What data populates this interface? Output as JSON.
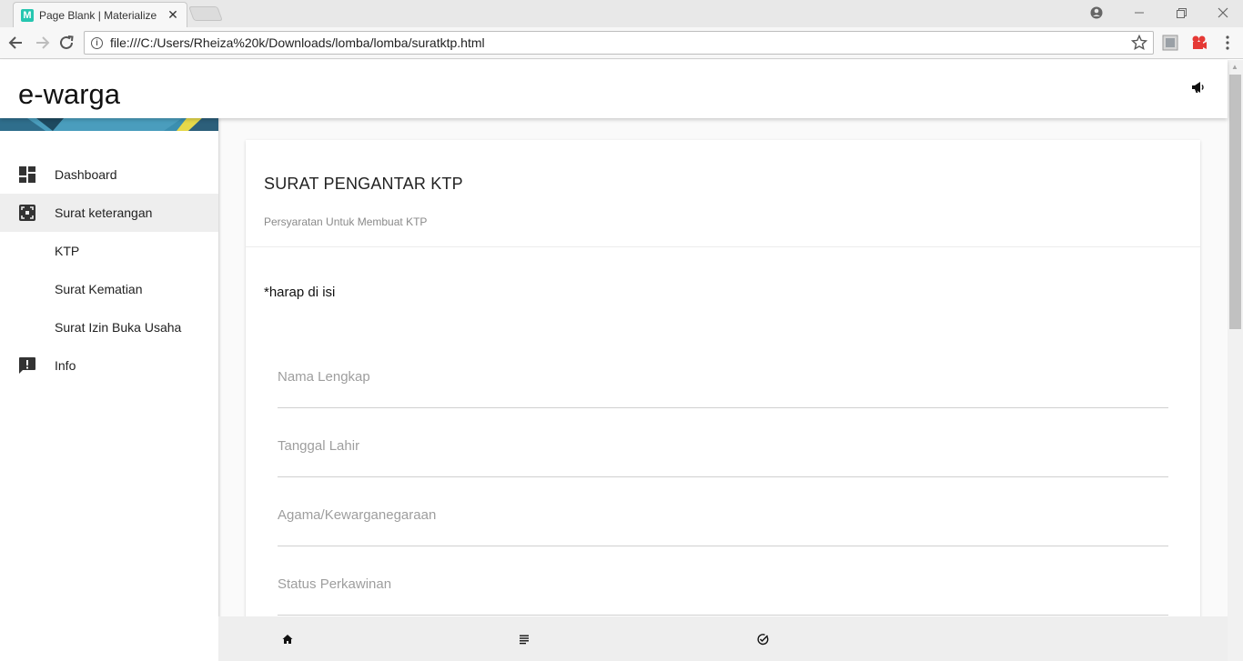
{
  "browser": {
    "tab_title": "Page Blank | Materialize -",
    "tab_favicon": "M",
    "close_glyph": "✕",
    "url": "file:///C:/Users/Rheiza%20k/Downloads/lomba/lomba/suratktp.html"
  },
  "header": {
    "brand": "e-warga"
  },
  "sidebar": {
    "items": [
      {
        "label": "Dashboard",
        "icon": "dashboard-icon"
      },
      {
        "label": "Surat keterangan",
        "icon": "surat-icon",
        "active": true
      },
      {
        "label": "KTP"
      },
      {
        "label": "Surat Kematian"
      },
      {
        "label": "Surat Izin Buka Usaha"
      },
      {
        "label": "Info",
        "icon": "feedback-icon"
      }
    ]
  },
  "card": {
    "title": "SURAT PENGANTAR KTP",
    "subtitle": "Persyaratan Untuk Membuat KTP",
    "note": "*harap di isi",
    "fields": [
      {
        "placeholder": "Nama Lengkap"
      },
      {
        "placeholder": "Tanggal Lahir"
      },
      {
        "placeholder": "Agama/Kewarganegaraan"
      },
      {
        "placeholder": "Status Perkawinan"
      }
    ]
  },
  "bottom_nav": {
    "icons": [
      "home-icon",
      "list-icon",
      "check-circle-icon"
    ]
  },
  "colors": {
    "accent_banner": "#3b8fb0",
    "active_bg": "#eeeeee",
    "bottom_bar": "#eeeeee"
  }
}
